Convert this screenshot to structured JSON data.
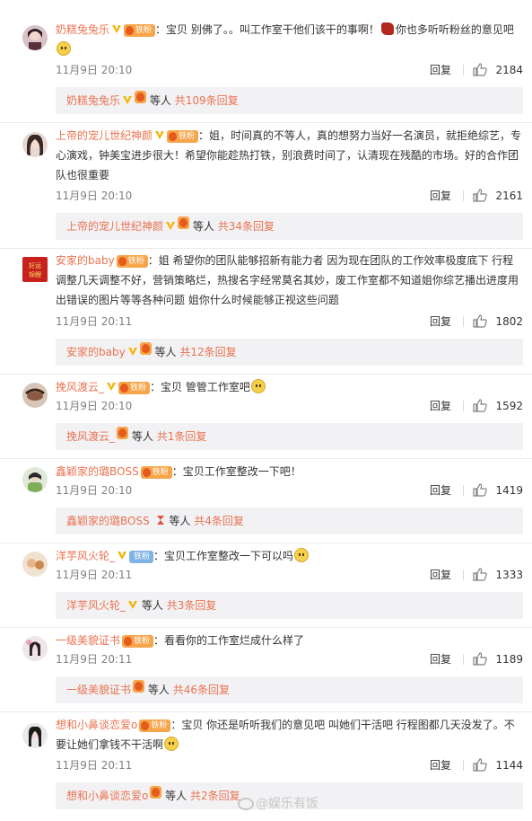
{
  "ui": {
    "reply_label": "回复",
    "others_label": "等人",
    "fan_badge": "铁粉",
    "fan_badge_blue": "铁粉"
  },
  "comments": [
    {
      "user": "奶糕兔兔乐",
      "text_before": "：宝贝 别佛了。。叫工作室干他们该干的事啊！",
      "text_after": "你也多听听粉丝的意见吧",
      "time": "11月9日 20:10",
      "likes": "2184",
      "sub_user": "奶糕兔兔乐",
      "sub_total": "共109条回复"
    },
    {
      "user": "上帝的宠儿世纪神颜",
      "text": "：姐，时间真的不等人，真的想努力当好一名演员，就拒绝综艺，专心演戏，钟美宝进步很大！希望你能趁热打铁，别浪费时间了，认清现在残酷的市场。好的合作团队也很重要",
      "time": "11月9日 20:10",
      "likes": "2161",
      "sub_user": "上帝的宠儿世纪神颜",
      "sub_total": "共34条回复"
    },
    {
      "user": "安家的baby",
      "avatar_text": "好运\n锦鲤",
      "text": "：姐 希望你的团队能够招新有能力者 因为现在团队的工作效率极度底下 行程调整几天调整不好，营销策略烂，热搜名字经常莫名其妙，废工作室都不知道姐你综艺播出进度用出错误的图片等等各种问题 姐你什么时候能够正视这些问题",
      "time": "11月9日 20:11",
      "likes": "1802",
      "sub_user": "安家的baby",
      "sub_total": "共12条回复"
    },
    {
      "user": "挽风渡云_",
      "text": "：宝贝 管管工作室吧",
      "time": "11月9日 20:10",
      "likes": "1592",
      "sub_user": "挽风渡云_",
      "sub_total": "共1条回复"
    },
    {
      "user": "鑫颖家的璐BOSS",
      "text": "：宝贝工作室整改一下吧！",
      "time": "11月9日 20:10",
      "likes": "1419",
      "sub_user": "鑫颖家的璐BOSS",
      "sub_total": "共4条回复"
    },
    {
      "user": "洋芋风火轮_",
      "text": "：宝贝工作室整改一下可以吗",
      "time": "11月9日 20:11",
      "likes": "1333",
      "sub_user": "洋芋风火轮_",
      "sub_total": "共3条回复"
    },
    {
      "user": "一级美貌证书",
      "text": "：看看你的工作室烂成什么样了",
      "time": "11月9日 20:11",
      "likes": "1189",
      "sub_user": "一级美貌证书",
      "sub_total": "共46条回复"
    },
    {
      "user": "想和小鼻谈恋爱o",
      "text": "：宝贝 你还是听听我们的意见吧 叫她们干活吧 行程图都几天没发了。不要让她们拿钱不干活啊",
      "time": "11月9日 20:11",
      "likes": "1144",
      "sub_user": "想和小鼻谈恋爱o",
      "sub_total": "共2条回复"
    }
  ],
  "watermark": "@娱乐有饭",
  "colors": {
    "username": "#eb7350",
    "link": "#eb7350",
    "meta": "#808080",
    "sub_bg": "#f2f2f5"
  }
}
